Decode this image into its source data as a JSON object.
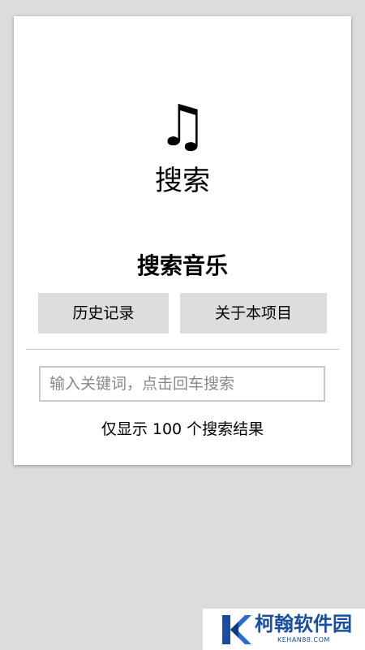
{
  "app": {
    "icon": "music-note-icon",
    "icon_glyph": "♫",
    "title": "搜索"
  },
  "main": {
    "section_title": "搜索音乐",
    "buttons": {
      "history_label": "历史记录",
      "about_label": "关于本项目"
    },
    "search": {
      "value": "",
      "placeholder": "输入关键词，点击回车搜索"
    },
    "result_note": "仅显示 100 个搜索结果"
  },
  "watermark": {
    "title": "柯翰软件园",
    "subtitle": "KEHAN88.COM"
  },
  "colors": {
    "background": "#dcdcdc",
    "card": "#ffffff",
    "button": "#dddddd",
    "watermark_blue": "#1a4fa0"
  }
}
